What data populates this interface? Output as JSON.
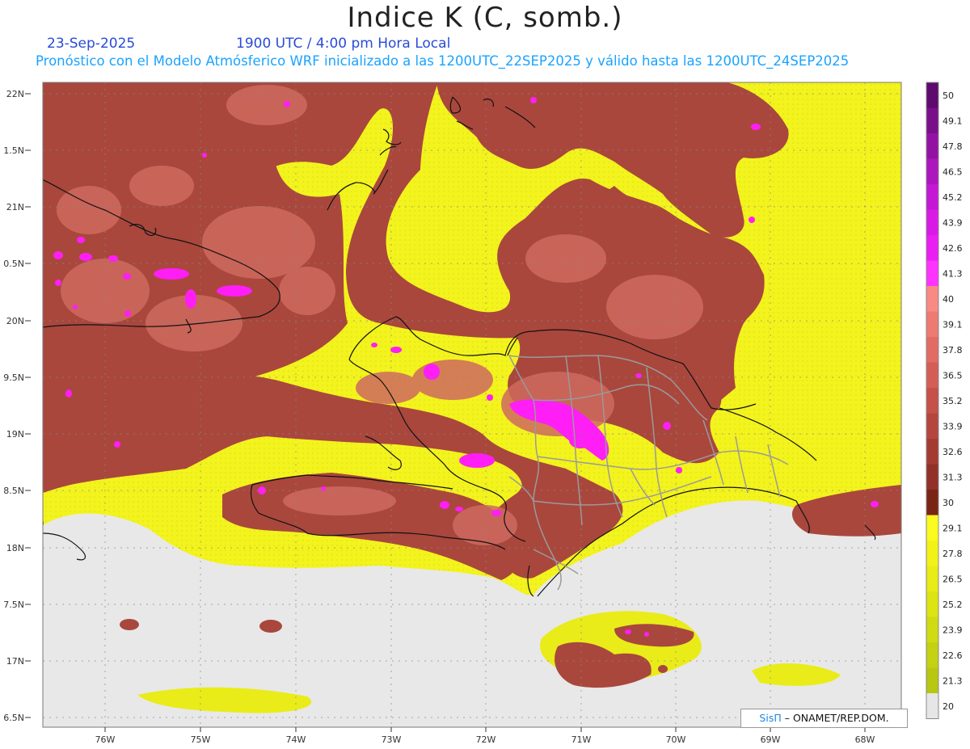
{
  "header": {
    "title": "Indice K (C, somb.)",
    "date": "23-Sep-2025",
    "time": "1900 UTC / 4:00 pm Hora Local",
    "subtitle": "Pronóstico con el Modelo Atmósferico WRF inicializado a las 1200UTC_22SEP2025 y válido hasta las  1200UTC_24SEP2025"
  },
  "map": {
    "lat_labels": [
      "22N",
      "1.5N",
      "21N",
      "0.5N",
      "20N",
      "9.5N",
      "19N",
      "8.5N",
      "18N",
      "7.5N",
      "17N",
      "6.5N"
    ],
    "lon_labels": [
      "76W",
      "75W",
      "74W",
      "73W",
      "72W",
      "71W",
      "70W",
      "69W",
      "68W"
    ]
  },
  "colorbar": {
    "labels": [
      "50",
      "49.1",
      "47.8",
      "46.5",
      "45.2",
      "43.9",
      "42.6",
      "41.3",
      "40",
      "39.1",
      "37.8",
      "36.5",
      "35.2",
      "33.9",
      "32.6",
      "31.3",
      "30",
      "29.1",
      "27.8",
      "26.5",
      "25.2",
      "23.9",
      "22.6",
      "21.3",
      "20"
    ],
    "colors": [
      "#5e0a6e",
      "#7a0f8a",
      "#9312a4",
      "#ad15bd",
      "#c418d4",
      "#d91ae6",
      "#ea1ef2",
      "#ff33ff",
      "#f88a83",
      "#ee7a72",
      "#e26c63",
      "#d45e55",
      "#c55148",
      "#b5463d",
      "#a43b33",
      "#92302a",
      "#7a2415",
      "#fafa1e",
      "#f2f218",
      "#e8eb16",
      "#dde413",
      "#d0da12",
      "#c4d112",
      "#b8c711",
      "#e6e6e6"
    ]
  },
  "credit": {
    "brand": "SisΠ",
    "text": "– ONAMET/REP.DOM."
  },
  "colors": {
    "yellow": "#f3f31d",
    "brown": "#a9473d",
    "salmon": "#d06a5f",
    "magenta": "#ff1ef5",
    "gray": "#e8e8e8"
  }
}
